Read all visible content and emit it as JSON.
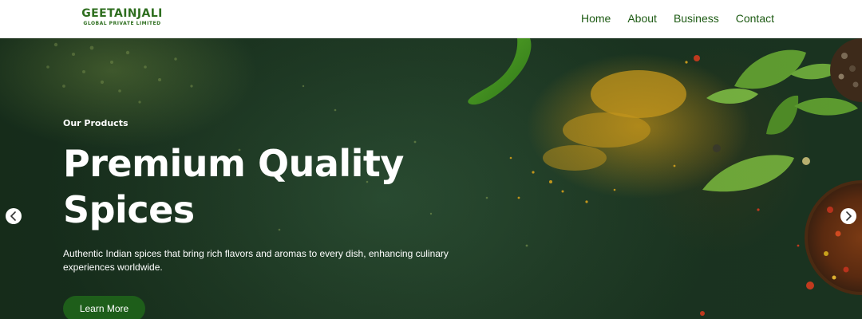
{
  "header": {
    "logo": {
      "name": "GEETAINJALI",
      "tagline": "GLOBAL PRIVATE LIMITED"
    },
    "nav": [
      {
        "label": "Home"
      },
      {
        "label": "About"
      },
      {
        "label": "Business"
      },
      {
        "label": "Contact"
      }
    ]
  },
  "hero": {
    "eyebrow": "Our Products",
    "title_line1": "Premium Quality",
    "title_line2": "Spices",
    "description": "Authentic Indian spices that bring rich flavors and aromas to every dish, enhancing culinary experiences worldwide.",
    "cta_label": "Learn More",
    "prev_icon": "chevron-left-icon",
    "next_icon": "chevron-right-icon"
  },
  "colors": {
    "brand_green": "#2e6e1f",
    "nav_text": "#1e5b14",
    "cta_bg": "#1e5e1a",
    "hero_bg": "#213d27",
    "turmeric": "#c79a1e",
    "chili": "#3d8b1c",
    "basil": "#6fa83a"
  }
}
